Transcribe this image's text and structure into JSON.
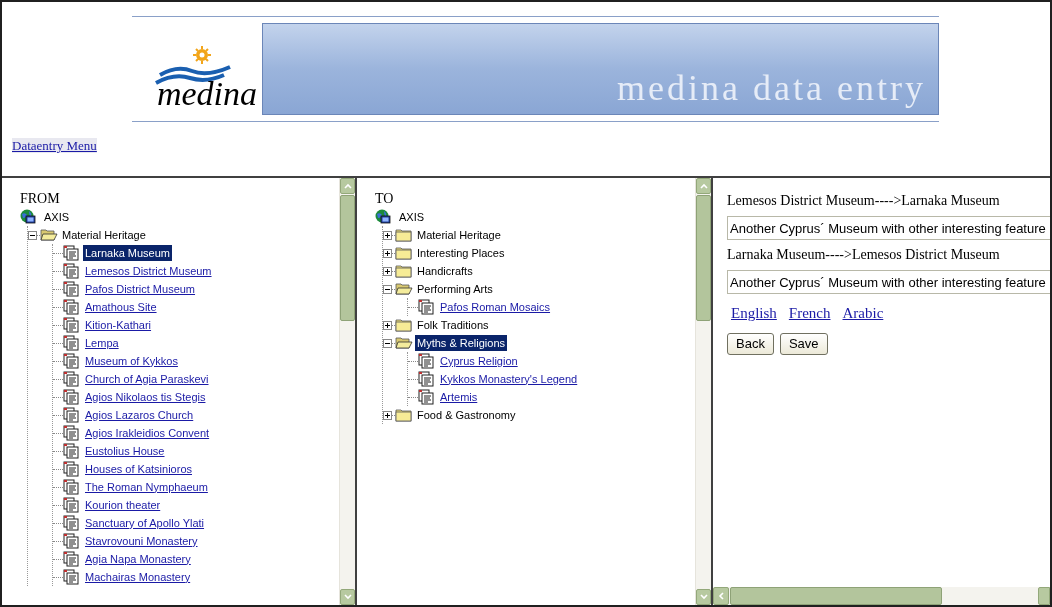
{
  "header": {
    "logo_text": "medina",
    "banner_title": "medina data entry",
    "menu_link": "Dataentry Menu"
  },
  "from_panel": {
    "heading": "FROM",
    "tree": [
      {
        "label": "AXIS",
        "kind": "root",
        "children": [
          {
            "label": "Material Heritage",
            "kind": "folder",
            "expanded": true,
            "selected": false,
            "children": [
              {
                "label": "Larnaka Museum",
                "kind": "document",
                "selected": true
              },
              {
                "label": "Lemesos District Museum",
                "kind": "document",
                "selected": false
              },
              {
                "label": "Pafos District Museum",
                "kind": "document",
                "selected": false
              },
              {
                "label": "Amathous Site",
                "kind": "document",
                "selected": false
              },
              {
                "label": "Kition-Kathari",
                "kind": "document",
                "selected": false
              },
              {
                "label": "Lempa",
                "kind": "document",
                "selected": false
              },
              {
                "label": "Museum of Kykkos",
                "kind": "document",
                "selected": false
              },
              {
                "label": "Church of  Agia Paraskevi",
                "kind": "document",
                "selected": false
              },
              {
                "label": "Agios Nikolaos tis Stegis",
                "kind": "document",
                "selected": false
              },
              {
                "label": "Agios Lazaros Church",
                "kind": "document",
                "selected": false
              },
              {
                "label": "Agios Irakleidios Convent",
                "kind": "document",
                "selected": false
              },
              {
                "label": "Eustolius House",
                "kind": "document",
                "selected": false
              },
              {
                "label": "Houses of Katsinioros",
                "kind": "document",
                "selected": false
              },
              {
                "label": "The Roman Nymphaeum",
                "kind": "document",
                "selected": false
              },
              {
                "label": "Kourion theater",
                "kind": "document",
                "selected": false
              },
              {
                "label": "Sanctuary of Apollo Ylati",
                "kind": "document",
                "selected": false
              },
              {
                "label": "Stavrovouni Monastery",
                "kind": "document",
                "selected": false
              },
              {
                "label": "Agia Napa Monastery",
                "kind": "document",
                "selected": false
              },
              {
                "label": "Machairas Monastery",
                "kind": "document",
                "selected": false
              }
            ]
          }
        ]
      }
    ]
  },
  "to_panel": {
    "heading": "TO",
    "tree": [
      {
        "label": "AXIS",
        "kind": "root",
        "children": [
          {
            "label": "Material Heritage",
            "kind": "folder",
            "expanded": false,
            "selected": false
          },
          {
            "label": "Interesting Places",
            "kind": "folder",
            "expanded": false,
            "selected": false
          },
          {
            "label": "Handicrafts",
            "kind": "folder",
            "expanded": false,
            "selected": false
          },
          {
            "label": "Performing Arts",
            "kind": "folder",
            "expanded": true,
            "selected": false,
            "children": [
              {
                "label": "Pafos Roman Mosaics",
                "kind": "document",
                "selected": false
              }
            ]
          },
          {
            "label": "Folk Traditions",
            "kind": "folder",
            "expanded": false,
            "selected": false
          },
          {
            "label": "Myths & Religions",
            "kind": "folder",
            "expanded": true,
            "selected": true,
            "children": [
              {
                "label": "Cyprus Religion",
                "kind": "document",
                "selected": false
              },
              {
                "label": "Kykkos Monastery's Legend",
                "kind": "document",
                "selected": false
              },
              {
                "label": "Artemis",
                "kind": "document",
                "selected": false
              }
            ]
          },
          {
            "label": "Food & Gastronomy",
            "kind": "folder",
            "expanded": false,
            "selected": false
          }
        ]
      }
    ]
  },
  "relations": [
    {
      "title": "Lemesos District Museum---->Larnaka Museum",
      "value": "Another Cyprus´ Museum with other interesting feature"
    },
    {
      "title": "Larnaka Museum---->Lemesos District Museum",
      "value": "Another Cyprus´ Museum with other interesting feature"
    }
  ],
  "languages": [
    "English",
    "French",
    "Arabic"
  ],
  "buttons": [
    "Back",
    "Save"
  ]
}
